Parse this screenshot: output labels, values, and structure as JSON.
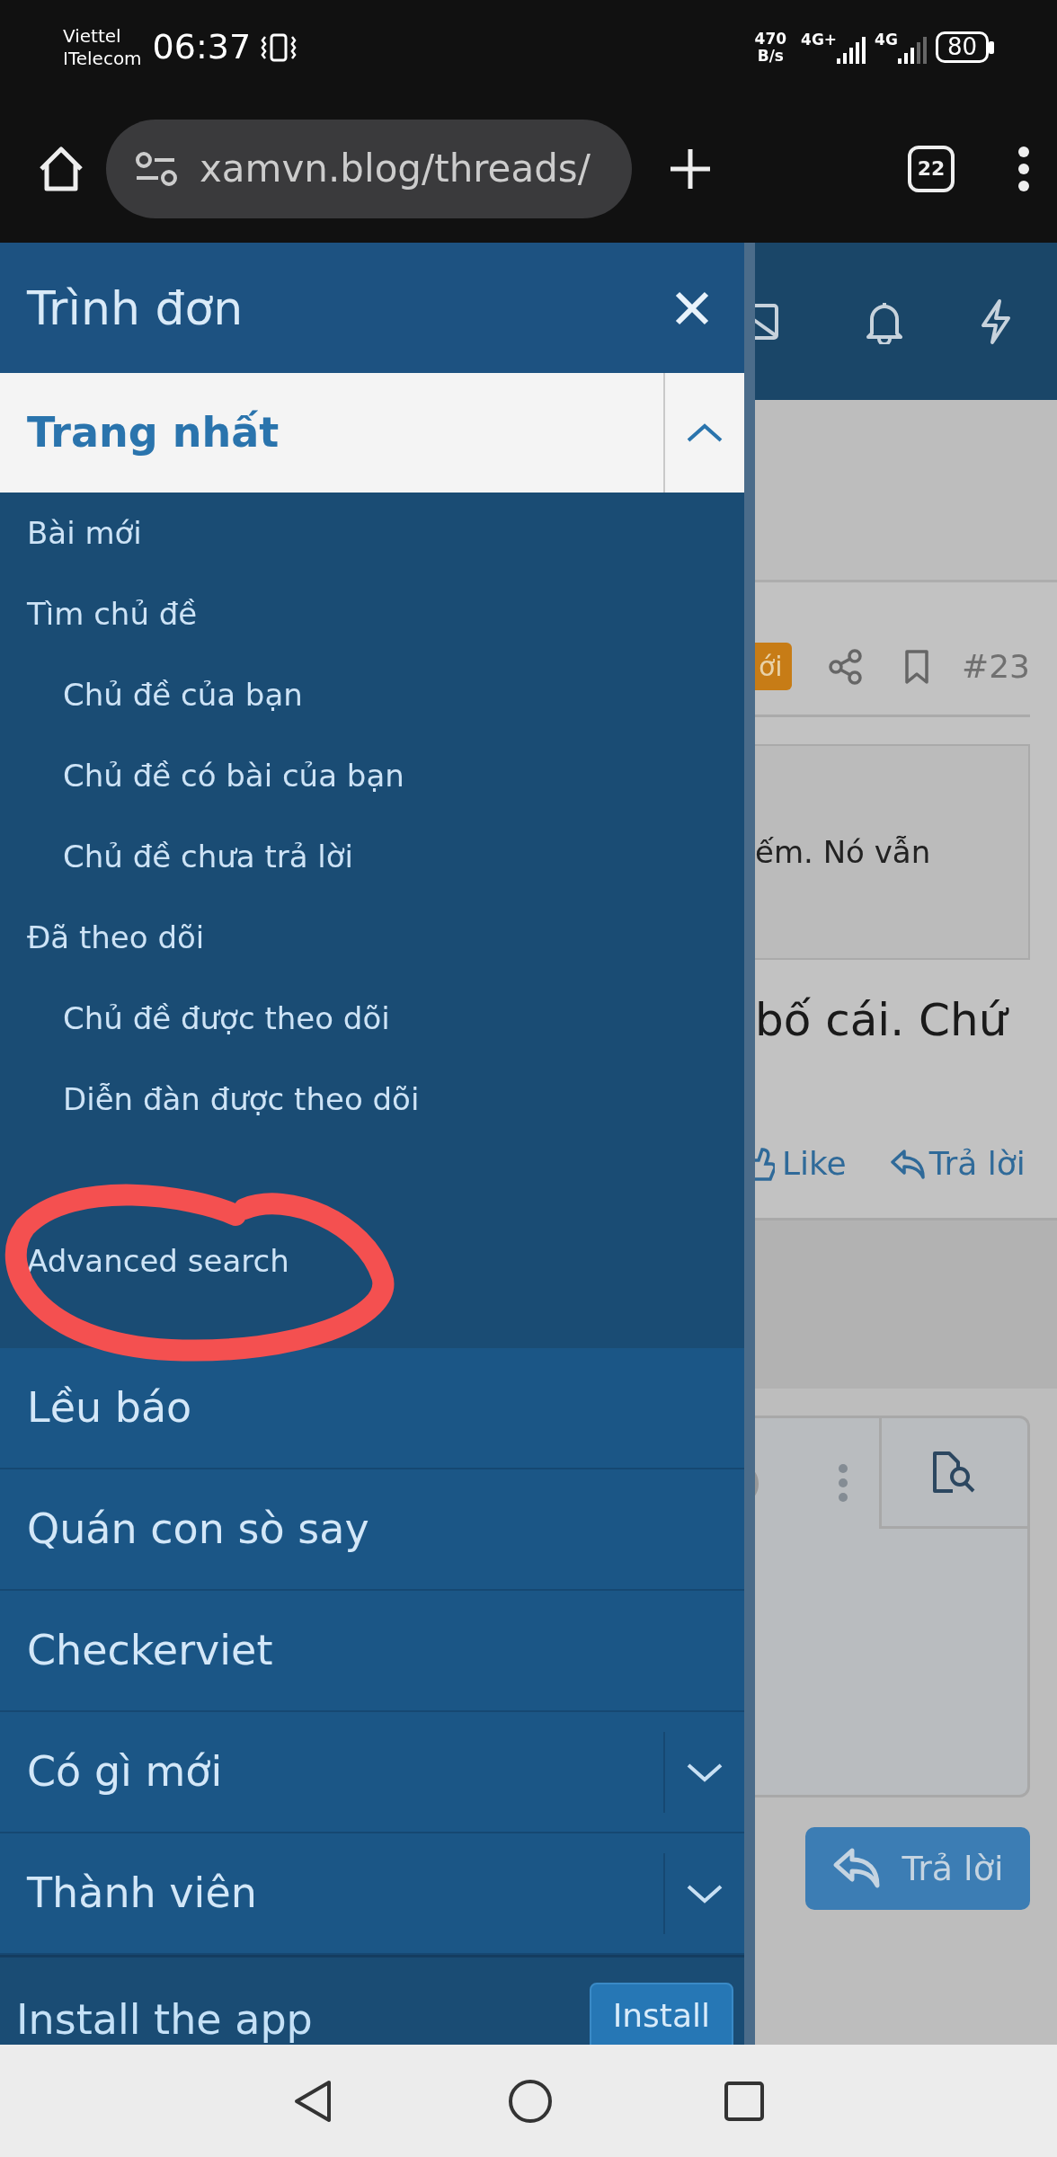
{
  "status_bar": {
    "carrier": [
      "Viettel",
      "ITelecom"
    ],
    "time": "06:37",
    "speed": [
      "470",
      "B/s"
    ],
    "networks": [
      "4G+",
      "4G"
    ],
    "battery": "80"
  },
  "browser": {
    "url": "xamvn.blog/threads/",
    "tab_count": "22"
  },
  "menu": {
    "title": "Trình đơn",
    "sections": [
      {
        "label": "Trang nhất",
        "kind": "group",
        "expanded": true,
        "children": [
          {
            "label": "Bài mới"
          },
          {
            "label": "Tìm chủ đề",
            "children": [
              {
                "label": "Chủ đề của bạn"
              },
              {
                "label": "Chủ đề có bài của bạn"
              },
              {
                "label": "Chủ đề chưa trả lời"
              }
            ]
          },
          {
            "label": "Đã theo dõi",
            "children": [
              {
                "label": "Chủ đề được theo dõi"
              },
              {
                "label": "Diễn đàn được theo dõi"
              }
            ]
          },
          {
            "label": "Advanced search"
          }
        ]
      },
      {
        "label": "Lều báo",
        "kind": "link"
      },
      {
        "label": "Quán con sò say",
        "kind": "link"
      },
      {
        "label": "Checkerviet",
        "kind": "link"
      },
      {
        "label": "Có gì mới",
        "kind": "group",
        "expanded": false
      },
      {
        "label": "Thành viên",
        "kind": "group",
        "expanded": false
      }
    ],
    "install": {
      "label": "Install the app",
      "button": "Install"
    }
  },
  "page": {
    "badge": "ới",
    "post_number": "#23",
    "quote_text": "ếm. Nó vẫn",
    "body_text": "bố cái. Chứ",
    "actions": [
      "Like",
      "Trả lời"
    ],
    "reply_button": "Trả lời"
  }
}
